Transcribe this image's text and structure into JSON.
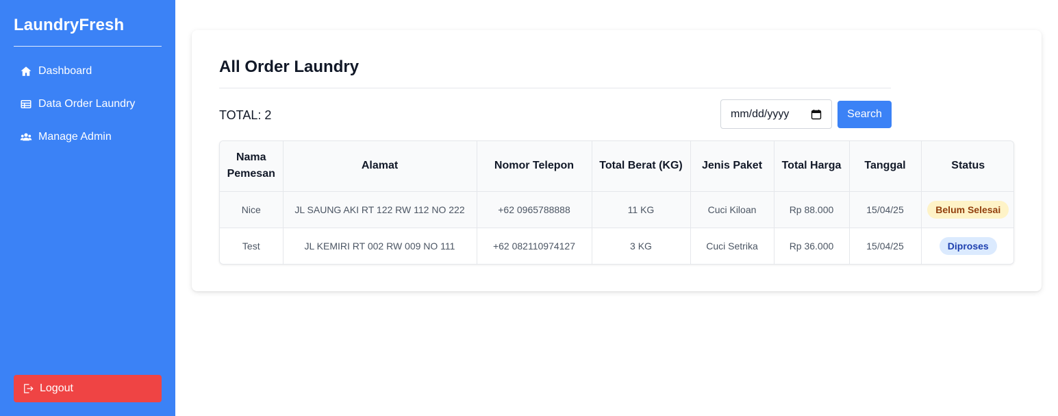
{
  "sidebar": {
    "brand": "LaundryFresh",
    "items": [
      {
        "label": "Dashboard",
        "icon": "home-icon"
      },
      {
        "label": "Data Order Laundry",
        "icon": "table-icon"
      },
      {
        "label": "Manage Admin",
        "icon": "users-icon"
      }
    ],
    "logout_label": "Logout"
  },
  "main": {
    "title": "All Order Laundry",
    "total_label": "TOTAL: 2",
    "date_placeholder": "mm/dd/yyyy",
    "search_label": "Search",
    "table": {
      "headers": [
        "Nama Pemesan",
        "Alamat",
        "Nomor Telepon",
        "Total Berat (KG)",
        "Jenis Paket",
        "Total Harga",
        "Tanggal",
        "Status"
      ],
      "rows": [
        {
          "nama": "Nice",
          "alamat": "JL SAUNG AKI RT 122 RW 112 NO 222",
          "telepon": "+62 0965788888",
          "berat": "11 KG",
          "paket": "Cuci Kiloan",
          "harga": "Rp 88.000",
          "tanggal": "15/04/25",
          "status": "Belum Selesai"
        },
        {
          "nama": "Test",
          "alamat": "JL KEMIRI RT 002 RW 009 NO 111",
          "telepon": "+62 082110974127",
          "berat": "3 KG",
          "paket": "Cuci Setrika",
          "harga": "Rp 36.000",
          "tanggal": "15/04/25",
          "status": "Diproses"
        }
      ]
    }
  },
  "colors": {
    "sidebar_bg": "#3b82f6",
    "logout_bg": "#ef4444",
    "accent": "#3b82f6",
    "status_pending_bg": "#fef3c7",
    "status_process_bg": "#dbeafe"
  }
}
